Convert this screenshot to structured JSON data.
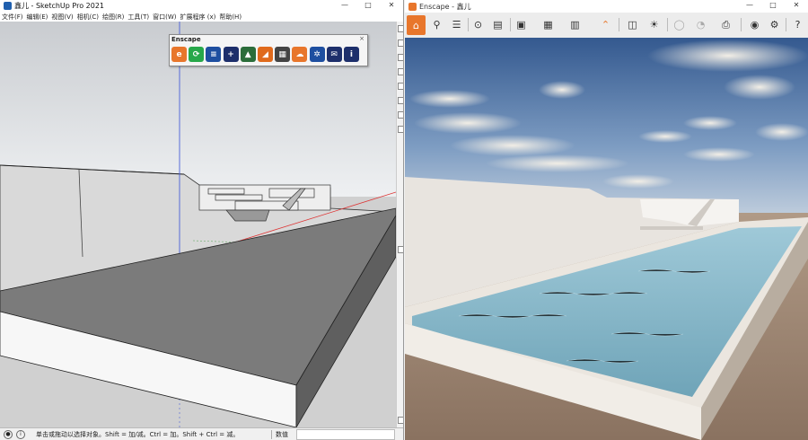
{
  "sketchup": {
    "title": "鑫儿 - SketchUp Pro 2021",
    "window_controls": [
      "—",
      "□",
      "✕"
    ],
    "menu": [
      "文件(F)",
      "编辑(E)",
      "视图(V)",
      "相机(C)",
      "绘图(R)",
      "工具(T)",
      "窗口(W)",
      "扩展程序 (x)",
      "帮助(H)"
    ],
    "enscape_toolbar": {
      "title": "Enscape",
      "close": "×",
      "icons": [
        {
          "name": "enscape-start-icon",
          "color": "#e8762b",
          "glyph": "e"
        },
        {
          "name": "sync-update-icon",
          "color": "#27a84a",
          "glyph": "⟳"
        },
        {
          "name": "sync-views-icon",
          "color": "#1e4fa0",
          "glyph": "≡"
        },
        {
          "name": "capture-add-icon",
          "color": "#1d2f6b",
          "glyph": "+"
        },
        {
          "name": "asset-library-icon",
          "color": "#2b6d3a",
          "glyph": "▲"
        },
        {
          "name": "material-editor-icon",
          "color": "#e06a1c",
          "glyph": "◢"
        },
        {
          "name": "material-library-icon",
          "color": "#444444",
          "glyph": "▦"
        },
        {
          "name": "upload-icon",
          "color": "#e8762b",
          "glyph": "☁"
        },
        {
          "name": "settings-icon",
          "color": "#1e4fa0",
          "glyph": "✲"
        },
        {
          "name": "feedback-mail-icon",
          "color": "#1d2f6b",
          "glyph": "✉"
        },
        {
          "name": "about-info-icon",
          "color": "#1d2f6b",
          "glyph": "i"
        }
      ]
    },
    "status": {
      "text": "单击或拖动以选择对象。Shift = 加/减。Ctrl = 加。Shift + Ctrl = 减。",
      "value_label": "数值"
    }
  },
  "enscape": {
    "title": "Enscape - 鑫儿",
    "window_controls": [
      "—",
      "□",
      "✕"
    ],
    "toolbar_icons": [
      "home-icon",
      "walk-mode-icon",
      "views-icon",
      "vr-icon",
      "video-editor-icon",
      "screenshot-icon",
      "batch-render-icon",
      "panorama-icon",
      "export-icon",
      "collapse-icon",
      "atlas-icon",
      "sun-info-icon",
      "asset-icon",
      "material-icon",
      "hide-icon",
      "settings-visual-icon",
      "settings-general-icon",
      "help-icon"
    ]
  },
  "colors": {
    "enscape_orange": "#e8762b",
    "ground_grey": "#7a7a7a",
    "pool_water": "#8fc1d2"
  }
}
